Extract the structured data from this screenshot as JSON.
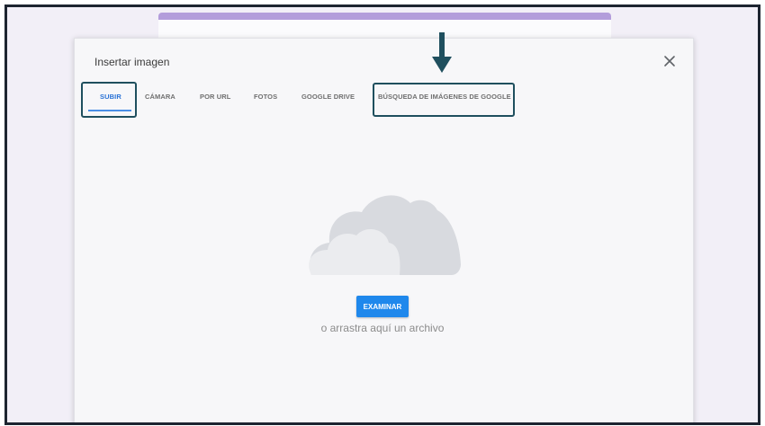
{
  "dialog": {
    "title": "Insertar imagen",
    "close_icon": "close-icon"
  },
  "tabs": [
    {
      "label": "SUBIR",
      "active": true
    },
    {
      "label": "CÁMARA",
      "active": false
    },
    {
      "label": "POR URL",
      "active": false
    },
    {
      "label": "FOTOS",
      "active": false
    },
    {
      "label": "GOOGLE DRIVE",
      "active": false
    },
    {
      "label": "BÚSQUEDA DE IMÁGENES DE GOOGLE",
      "active": false
    }
  ],
  "upload": {
    "illustration_icon": "cloud-icon",
    "button_label": "EXAMINAR",
    "hint": "o arrastra aquí un archivo"
  },
  "annotations": {
    "arrow_icon": "down-arrow-icon",
    "highlighted_tabs": [
      "SUBIR",
      "BÚSQUEDA DE IMÁGENES DE GOOGLE"
    ]
  },
  "colors": {
    "accent_blue": "#1f88ec",
    "active_tab": "#2a73d6",
    "form_header_purple": "#b39ddb",
    "callout_border": "#1f4f5e",
    "frame_border": "#1d2430"
  }
}
